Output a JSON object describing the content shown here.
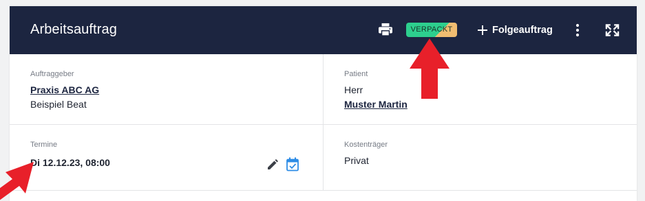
{
  "header": {
    "title": "Arbeitsauftrag",
    "status_badge": "VERPACKT",
    "followup_label": "Folgeauftrag"
  },
  "client": {
    "label": "Auftraggeber",
    "name": "Praxis ABC AG",
    "contact": "Beispiel Beat"
  },
  "patient": {
    "label": "Patient",
    "salutation": "Herr",
    "name": "Muster Martin"
  },
  "appointments": {
    "label": "Termine",
    "value": "Di 12.12.23, 08:00"
  },
  "payer": {
    "label": "Kostenträger",
    "value": "Privat"
  },
  "icons": {
    "print": "print-icon",
    "add": "plus-icon",
    "more": "more-vertical-icon",
    "expand": "fullscreen-icon",
    "edit": "pencil-icon",
    "calendar": "calendar-check-icon"
  },
  "colors": {
    "header_bg": "#1c2540",
    "badge_green": "#2dcf8e",
    "badge_orange": "#f1bd71",
    "calendar_blue": "#2d8ce6",
    "annotation_red": "#e8202a"
  }
}
